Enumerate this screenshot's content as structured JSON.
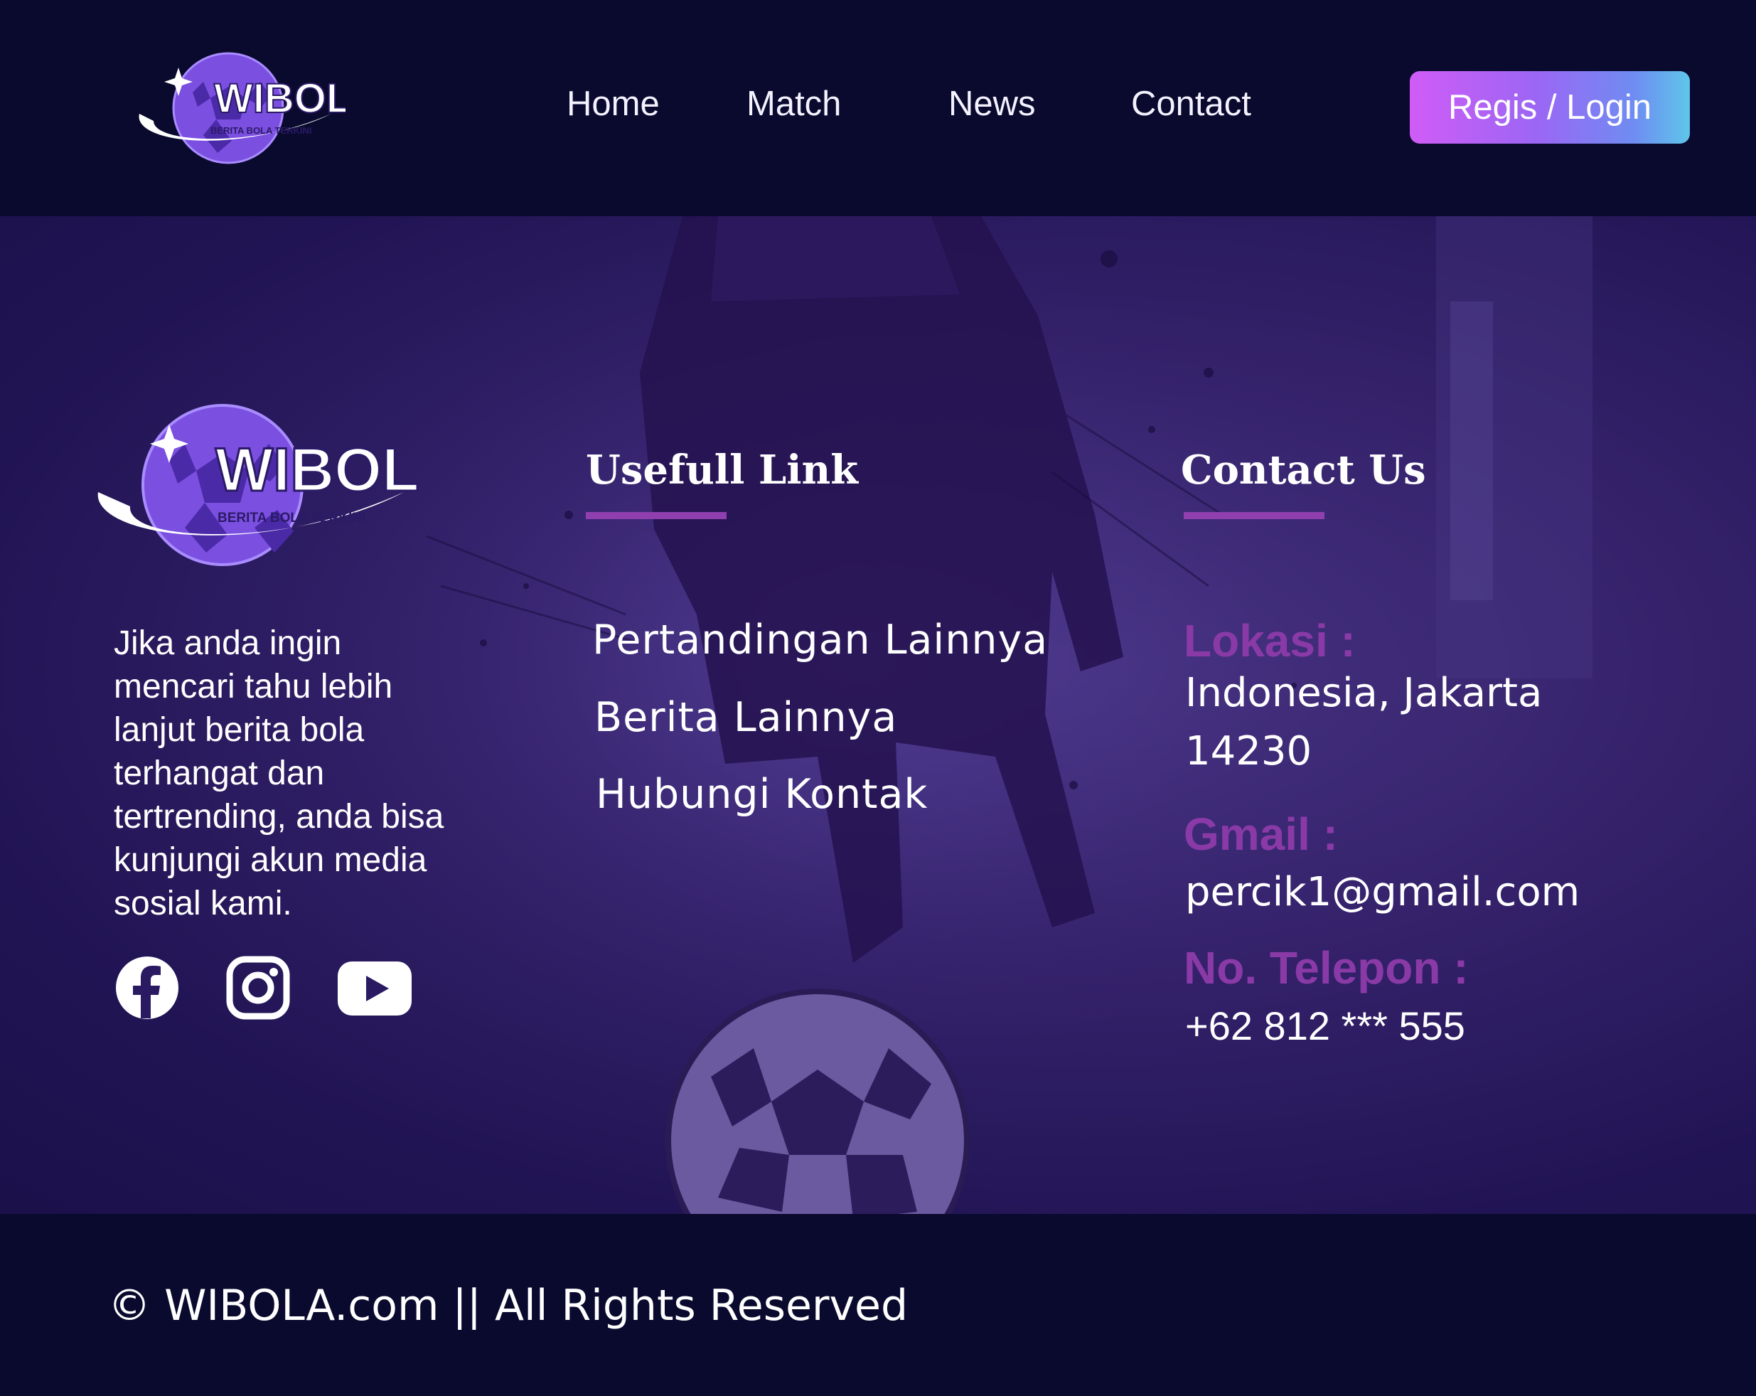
{
  "header": {
    "logo": {
      "word": "WIBOLA",
      "tagline": "BERITA BOLA TERKINI"
    },
    "nav": [
      "Home",
      "Match",
      "News",
      "Contact"
    ],
    "login_label": "Regis / Login",
    "login_gradient": [
      "#d05cf6",
      "#5ec6ea"
    ]
  },
  "footer": {
    "logo": {
      "word": "WIBOLA",
      "tagline": "BERITA BOLA TERKINI"
    },
    "about": "Jika anda ingin mencari tahu lebih lanjut berita bola terhangat dan tertrending, anda bisa kunjungi akun media sosial kami.",
    "social": [
      "facebook-icon",
      "instagram-icon",
      "youtube-icon"
    ],
    "useful_title": "Usefull Link",
    "links": [
      "Pertandingan Lainnya",
      "Berita Lainnya",
      "Hubungi Kontak"
    ],
    "contact_title": "Contact Us",
    "contact": {
      "location_label": "Lokasi :",
      "location_value": "Indonesia, Jakarta 14230",
      "gmail_label": "Gmail :",
      "gmail_value": "percik1@gmail.com",
      "phone_label": "No. Telepon :",
      "phone_value": "+62 812 *** 555"
    },
    "accent_color": "#8a3aa6"
  },
  "bottom": {
    "copyright": "© WIBOLA.com || All Rights Reserved"
  },
  "colors": {
    "background": "#090a2e",
    "hero": "#34216a"
  }
}
